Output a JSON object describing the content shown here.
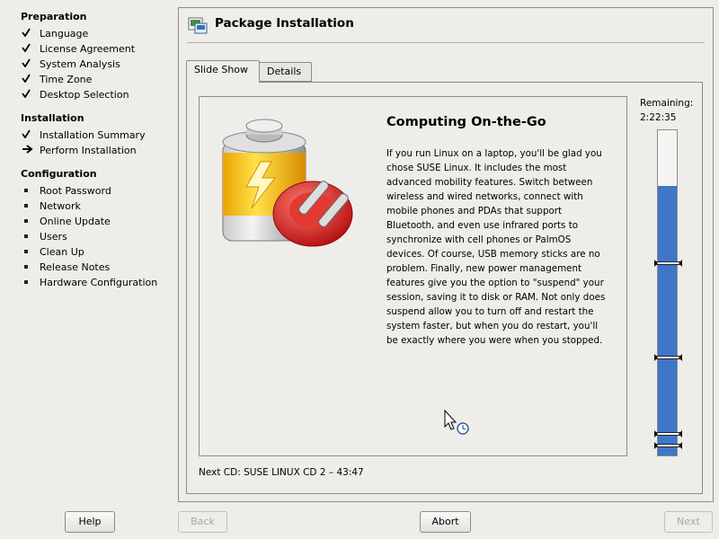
{
  "sidebar": {
    "sections": [
      {
        "title": "Preparation",
        "steps": [
          {
            "label": "Language",
            "status": "done"
          },
          {
            "label": "License Agreement",
            "status": "done"
          },
          {
            "label": "System Analysis",
            "status": "done"
          },
          {
            "label": "Time Zone",
            "status": "done"
          },
          {
            "label": "Desktop Selection",
            "status": "done"
          }
        ]
      },
      {
        "title": "Installation",
        "steps": [
          {
            "label": "Installation Summary",
            "status": "done"
          },
          {
            "label": "Perform Installation",
            "status": "current"
          }
        ]
      },
      {
        "title": "Configuration",
        "steps": [
          {
            "label": "Root Password",
            "status": "pending"
          },
          {
            "label": "Network",
            "status": "pending"
          },
          {
            "label": "Online Update",
            "status": "pending"
          },
          {
            "label": "Users",
            "status": "pending"
          },
          {
            "label": "Clean Up",
            "status": "pending"
          },
          {
            "label": "Release Notes",
            "status": "pending"
          },
          {
            "label": "Hardware Configuration",
            "status": "pending"
          }
        ]
      }
    ]
  },
  "header": {
    "title": "Package Installation",
    "icon": "package-install-icon"
  },
  "tabs": [
    {
      "label": "Slide Show",
      "active": true
    },
    {
      "label": "Details",
      "active": false
    }
  ],
  "slide": {
    "heading": "Computing On-the-Go",
    "image": "battery-plug-icon",
    "body": "If you run Linux on a laptop, you'll be glad you chose SUSE Linux. It includes the most advanced mobility features. Switch between wireless and wired networks, connect with mobile phones and PDAs that support Bluetooth, and even use infrared ports to synchronize with cell phones or PalmOS devices. Of course, USB memory sticks are no problem. Finally, new power management features give you the option to \"suspend\" your session, saving it to disk or RAM. Not only does suspend allow you to turn off and restart the system faster, but when you do restart, you'll be exactly where you were when you stopped."
  },
  "status": {
    "next_cd": "Next CD: SUSE LINUX CD 2 – 43:47",
    "remaining_label": "Remaining:",
    "remaining_time": "2:22:35",
    "progress_fraction": 0.83,
    "cd_boundaries": [
      0.41,
      0.7,
      0.935,
      0.97
    ]
  },
  "buttons": {
    "help": "Help",
    "back": "Back",
    "abort": "Abort",
    "next": "Next"
  },
  "colors": {
    "progress": "#3e76c8",
    "background": "#efedea"
  }
}
